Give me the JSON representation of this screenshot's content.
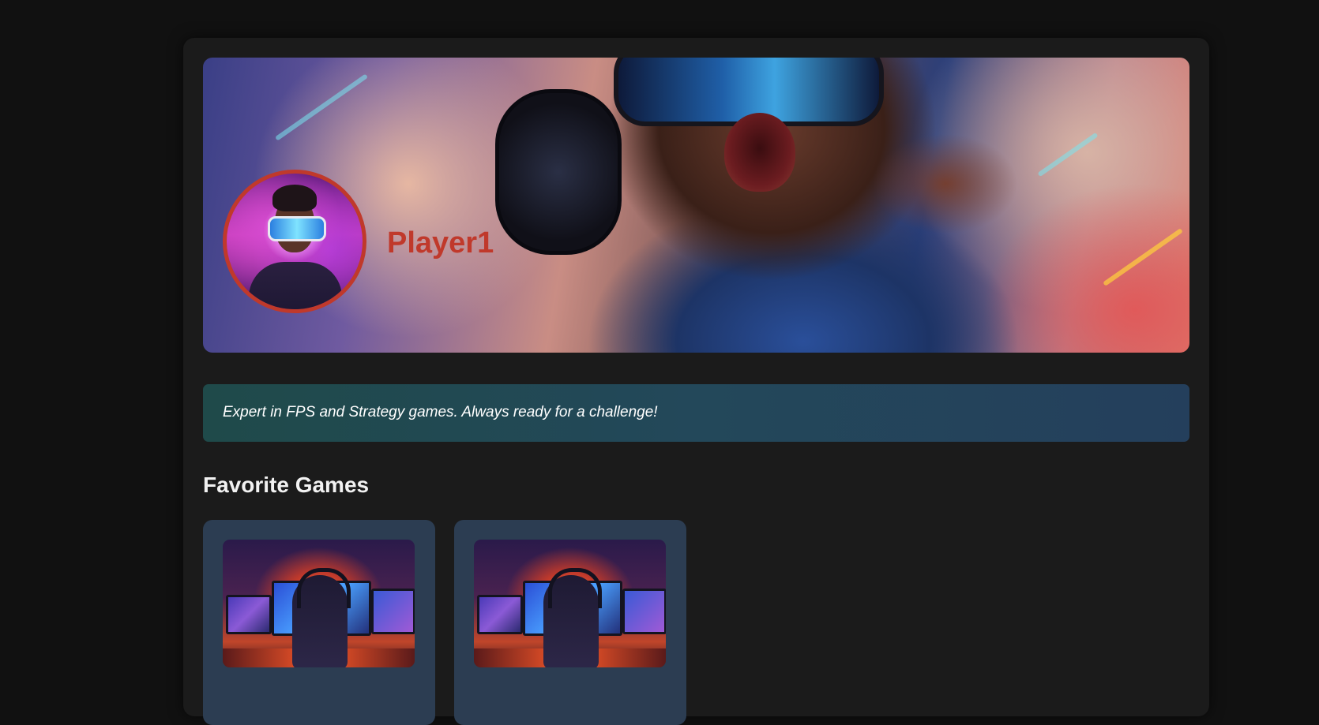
{
  "profile": {
    "username": "Player1",
    "bio": "Expert in FPS and Strategy games. Always ready for a challenge!",
    "accent_color": "#c0392b"
  },
  "favorites": {
    "title": "Favorite Games",
    "games": [
      {
        "thumbnail": "gamer-at-desk-image"
      },
      {
        "thumbnail": "gamer-at-desk-image"
      }
    ]
  },
  "colors": {
    "page_background": "#111111",
    "card_background": "#1b1b1b",
    "bio_background": "#23485a",
    "game_card_background": "#2c3d52"
  }
}
